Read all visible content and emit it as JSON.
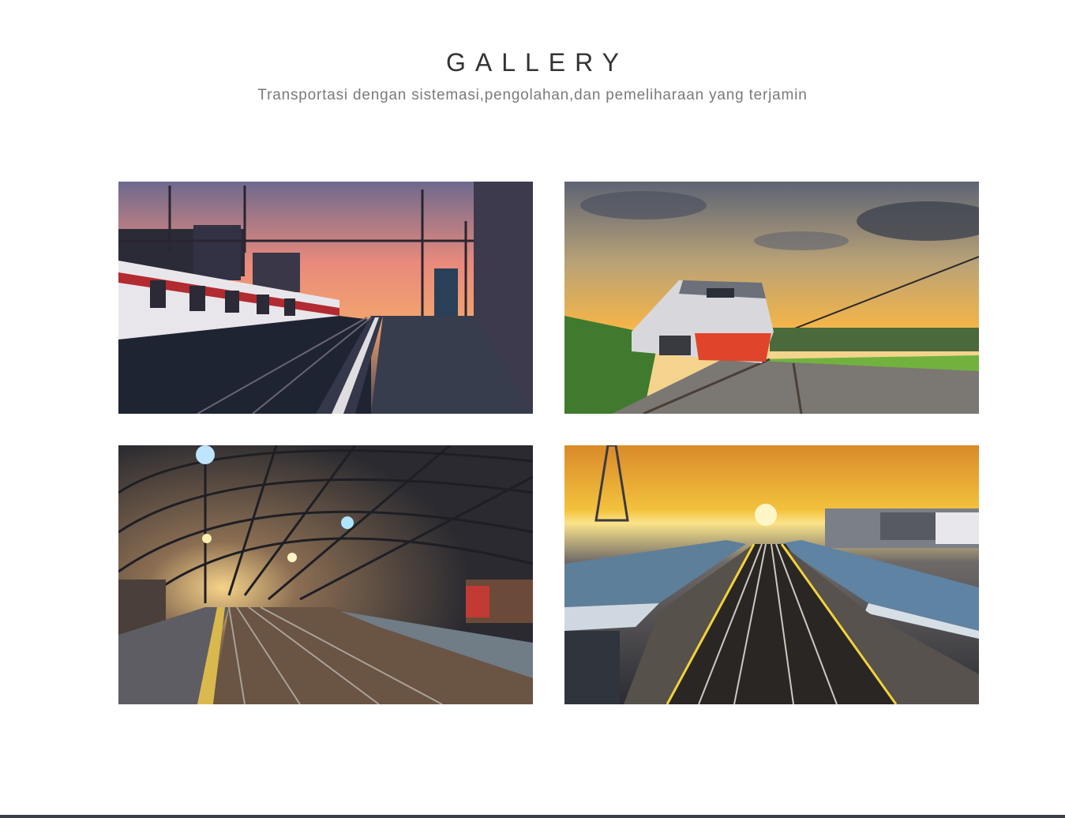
{
  "gallery": {
    "title": "GALLERY",
    "subtitle": "Transportasi dengan sistemasi,pengolahan,dan pemeliharaan yang terjamin",
    "images": [
      {
        "name": "train-station-sunset-photo"
      },
      {
        "name": "locomotive-field-photo"
      },
      {
        "name": "station-hall-night-photo"
      },
      {
        "name": "railway-platforms-sunrise-photo"
      }
    ]
  },
  "colors": {
    "title": "#333333",
    "subtitle": "#7a7a7a",
    "footer": "#3a3f48"
  }
}
